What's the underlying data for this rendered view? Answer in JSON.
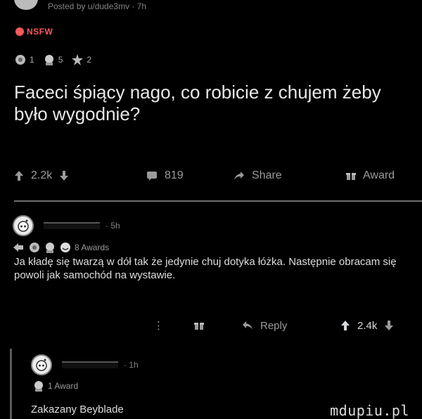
{
  "post": {
    "byline": "Posted by u/dude3mv · 7h",
    "nsfw_label": "NSFW",
    "awards": [
      {
        "icon": "helpful-award-icon",
        "count": "1"
      },
      {
        "icon": "wholesome-award-icon",
        "count": "5"
      },
      {
        "icon": "silver-award-icon",
        "count": "2"
      }
    ],
    "title": "Faceci śpiący nago, co robicie z chujem żeby było wygodnie?",
    "upvotes": "2.2k",
    "comments": "819",
    "share_label": "Share",
    "award_label": "Award"
  },
  "comment1": {
    "time": "· 5h",
    "awards_text": "8 Awards",
    "body": "Ja kładę się twarzą w dół tak że jedynie chuj dotyka łóżka. Następnie obracam się powoli jak samochód na wystawie.",
    "more": "⋮",
    "reply_label": "Reply",
    "votes": "2.4k"
  },
  "comment2": {
    "time": "· 1h",
    "awards_text": "1 Award",
    "body": "Zakazany Beyblade"
  },
  "watermark": "mdupiu.pl",
  "colors": {
    "nsfw": "#ff585b",
    "upvote_active": "#d7dadc"
  }
}
